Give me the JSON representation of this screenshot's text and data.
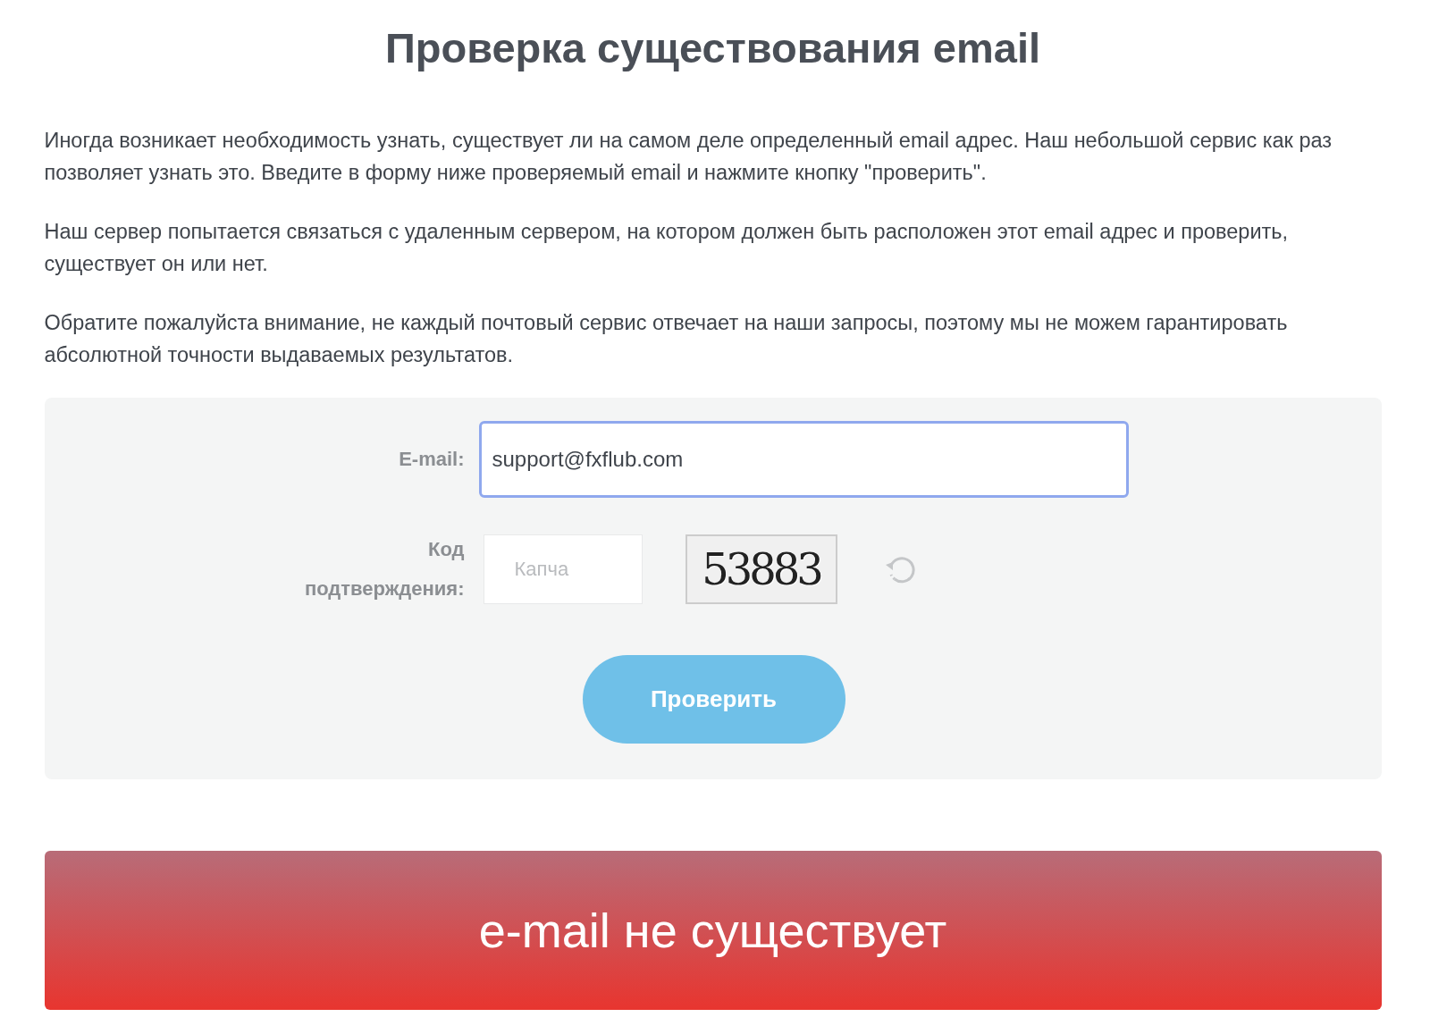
{
  "title": "Проверка существования email",
  "paragraphs": [
    "Иногда возникает необходимость узнать, существует ли на самом деле определенный email адрес. Наш небольшой сервис как раз позволяет узнать это. Введите в форму ниже проверяемый email и нажмите кнопку \"проверить\".",
    "Наш сервер попытается связаться с удаленным сервером, на котором должен быть расположен этот email адрес и проверить, существует он или нет.",
    "Обратите пожалуйста внимание, не каждый почтовый сервис отвечает на наши запросы, поэтому мы не можем гарантировать абсолютной точности выдаваемых результатов."
  ],
  "form": {
    "email_label": "E-mail:",
    "email_value": "support@fxflub.com",
    "captcha_label": "Код подтверждения:",
    "captcha_placeholder": "Капча",
    "captcha_image": "53883",
    "submit": "Проверить"
  },
  "result": {
    "text": "e-mail не существует",
    "exists": false
  }
}
